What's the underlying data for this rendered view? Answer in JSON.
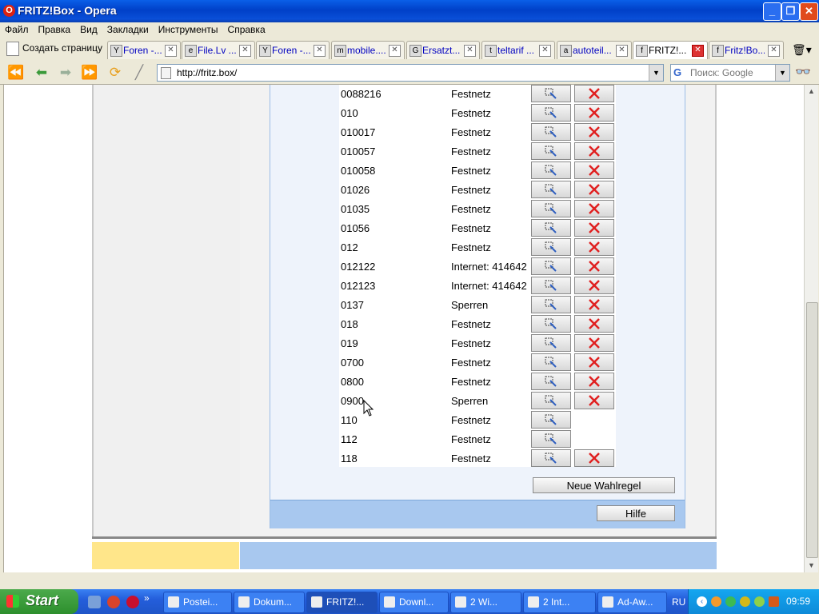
{
  "window": {
    "title": "FRITZ!Box - Opera"
  },
  "menu": [
    "Файл",
    "Правка",
    "Вид",
    "Закладки",
    "Инструменты",
    "Справка"
  ],
  "tabbar": {
    "new_page": "Создать страницу",
    "tabs": [
      {
        "label": "Foren -...",
        "icon": "Y"
      },
      {
        "label": "File.Lv ...",
        "icon": "e"
      },
      {
        "label": "Foren -...",
        "icon": "Y"
      },
      {
        "label": "mobile....",
        "icon": "m"
      },
      {
        "label": "Ersatzt...",
        "icon": "G"
      },
      {
        "label": "teltarif ...",
        "icon": "t"
      },
      {
        "label": "autoteil...",
        "icon": "a"
      },
      {
        "label": "FRITZ!...",
        "icon": "f",
        "active": true
      },
      {
        "label": "Fritz!Bo...",
        "icon": "f"
      }
    ]
  },
  "address": {
    "url": "http://fritz.box/"
  },
  "search": {
    "placeholder": "Поиск: Google"
  },
  "rules": [
    {
      "number": "0088216",
      "type": "Festnetz",
      "deletable": true
    },
    {
      "number": "010",
      "type": "Festnetz",
      "deletable": true
    },
    {
      "number": "010017",
      "type": "Festnetz",
      "deletable": true
    },
    {
      "number": "010057",
      "type": "Festnetz",
      "deletable": true
    },
    {
      "number": "010058",
      "type": "Festnetz",
      "deletable": true
    },
    {
      "number": "01026",
      "type": "Festnetz",
      "deletable": true
    },
    {
      "number": "01035",
      "type": "Festnetz",
      "deletable": true
    },
    {
      "number": "01056",
      "type": "Festnetz",
      "deletable": true
    },
    {
      "number": "012",
      "type": "Festnetz",
      "deletable": true
    },
    {
      "number": "012122",
      "type": "Internet: 414642",
      "deletable": true
    },
    {
      "number": "012123",
      "type": "Internet: 414642",
      "deletable": true
    },
    {
      "number": "0137",
      "type": "Sperren",
      "deletable": true
    },
    {
      "number": "018",
      "type": "Festnetz",
      "deletable": true
    },
    {
      "number": "019",
      "type": "Festnetz",
      "deletable": true
    },
    {
      "number": "0700",
      "type": "Festnetz",
      "deletable": true
    },
    {
      "number": "0800",
      "type": "Festnetz",
      "deletable": true
    },
    {
      "number": "0900",
      "type": "Sperren",
      "deletable": true
    },
    {
      "number": "110",
      "type": "Festnetz",
      "deletable": false
    },
    {
      "number": "112",
      "type": "Festnetz",
      "deletable": false
    },
    {
      "number": "118",
      "type": "Festnetz",
      "deletable": true
    }
  ],
  "buttons": {
    "new_rule": "Neue Wahlregel",
    "help": "Hilfe"
  },
  "taskbar": {
    "start": "Start",
    "tasks": [
      {
        "label": "Postei...",
        "active": false
      },
      {
        "label": "Dokum...",
        "active": false
      },
      {
        "label": "FRITZ!...",
        "active": true
      },
      {
        "label": "Downl...",
        "active": false
      },
      {
        "label": "2 Wi...",
        "active": false
      },
      {
        "label": "2 Int...",
        "active": false
      },
      {
        "label": "Ad-Aw...",
        "active": false
      }
    ],
    "lang": "RU",
    "clock": "09:59"
  },
  "colors": {
    "accent": "#245edb",
    "delete": "#e02020",
    "panel": "#a8c8ef",
    "sidebar_footer": "#ffe68a"
  }
}
